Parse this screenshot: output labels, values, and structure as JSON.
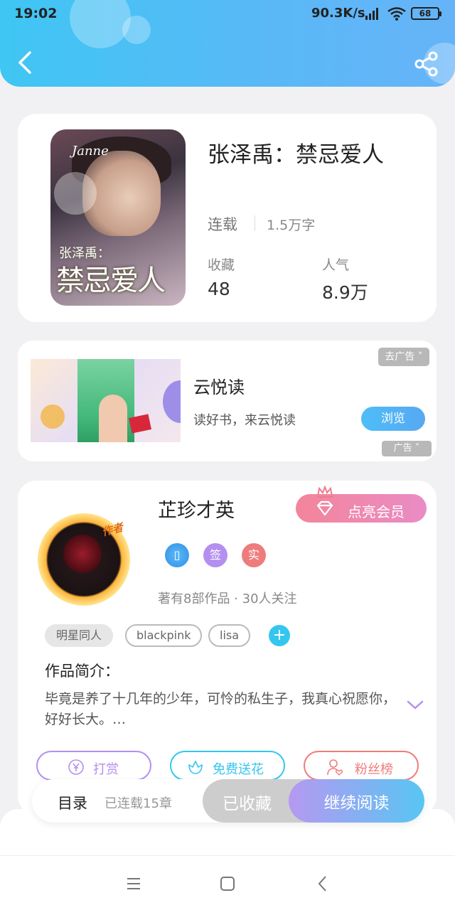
{
  "status_bar": {
    "time": "19:02",
    "net_speed": "90.3K/s",
    "battery": "68"
  },
  "book": {
    "title": "张泽禹：禁忌爱人",
    "status": "连载",
    "word_count": "1.5万字",
    "favorites_label": "收藏",
    "favorites_value": "48",
    "popularity_label": "人气",
    "popularity_value": "8.9万",
    "cover_title_small": "张泽禹：",
    "cover_title_big": "禁忌爱人",
    "cover_signature": "Janne"
  },
  "ad": {
    "app_name": "云悦读",
    "description": "读好书，来云悦读",
    "browse_label": "浏览",
    "remove_ad_label": "去广告",
    "ad_badge": "广告"
  },
  "author": {
    "name": "芷珍才英",
    "author_tag": "作者",
    "vip_label": "点亮会员",
    "badges": [
      "",
      "签",
      "实"
    ],
    "meta": "著有8部作品 · 30人关注",
    "tags": [
      "明星同人",
      "blackpink",
      "lisa"
    ],
    "add_tag": "+",
    "intro_title": "作品简介：",
    "intro_text": "毕竟是养了十几年的少年，可怜的私生子，我真心祝愿你，好好长大。…",
    "actions": {
      "tip": "打赏",
      "flower": "免费送花",
      "fans": "粉丝榜"
    }
  },
  "bottom_bar": {
    "toc_label": "目录",
    "toc_count": "已连载15章",
    "collected_label": "已收藏",
    "read_label": "继续阅读"
  },
  "colors": {
    "accent_blue": "#3fc6f3",
    "vip_pink": "#f3859a",
    "flower_cyan": "#34c6ef",
    "tip_purple": "#b48ff0",
    "fans_red": "#ef7c7c"
  }
}
